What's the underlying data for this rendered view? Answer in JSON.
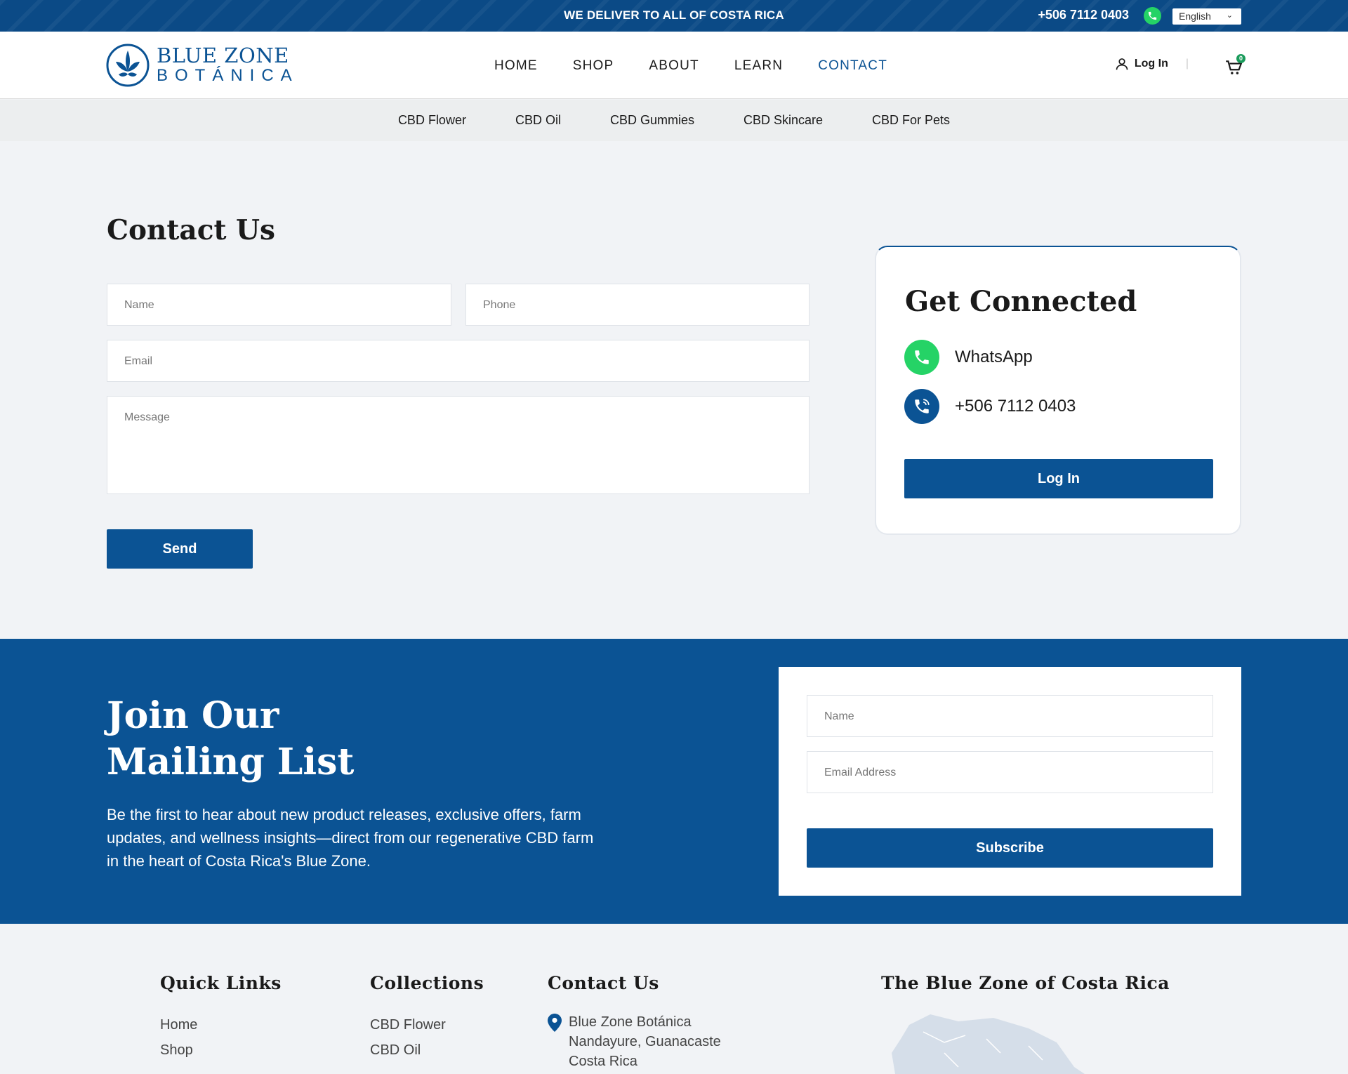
{
  "topbar": {
    "delivery_message": "WE DELIVER TO ALL OF COSTA RICA",
    "phone": "+506 7112 0403",
    "whatsapp_icon": "whatsapp-icon",
    "language": "English"
  },
  "header": {
    "logo_line1": "BLUE ZONE",
    "logo_line2": "BOTÁNICA",
    "nav": [
      "HOME",
      "SHOP",
      "ABOUT",
      "LEARN",
      "CONTACT"
    ],
    "active_nav": "CONTACT",
    "login": "Log In",
    "cart_count": "0"
  },
  "subnav": [
    "CBD Flower",
    "CBD Oil",
    "CBD Gummies",
    "CBD Skincare",
    "CBD For Pets"
  ],
  "contact_form": {
    "title": "Contact Us",
    "name_placeholder": "Name",
    "phone_placeholder": "Phone",
    "email_placeholder": "Email",
    "message_placeholder": "Message",
    "send_label": "Send"
  },
  "connect_card": {
    "title": "Get Connected",
    "whatsapp_label": "WhatsApp",
    "phone_label": "+506 7112 0403",
    "login_label": "Log In"
  },
  "mailing": {
    "title_line1": "Join Our",
    "title_line2": "Mailing List",
    "description": "Be the first to hear about new product releases, exclusive offers, farm updates, and wellness insights—direct from our regenerative CBD farm in the heart of Costa Rica's Blue Zone.",
    "name_placeholder": "Name",
    "email_placeholder": "Email Address",
    "subscribe_label": "Subscribe"
  },
  "footer": {
    "quick_links_title": "Quick Links",
    "quick_links": [
      "Home",
      "Shop"
    ],
    "collections_title": "Collections",
    "collections": [
      "CBD Flower",
      "CBD Oil"
    ],
    "contact_title": "Contact Us",
    "address": [
      "Blue Zone Botánica",
      "Nandayure, Guanacaste",
      "Costa Rica"
    ],
    "map_title": "The Blue Zone of Costa Rica"
  },
  "colors": {
    "brand_blue": "#0b5394",
    "topbar_blue": "#0b4a86",
    "whatsapp_green": "#25d366",
    "page_bg": "#f1f3f6"
  }
}
